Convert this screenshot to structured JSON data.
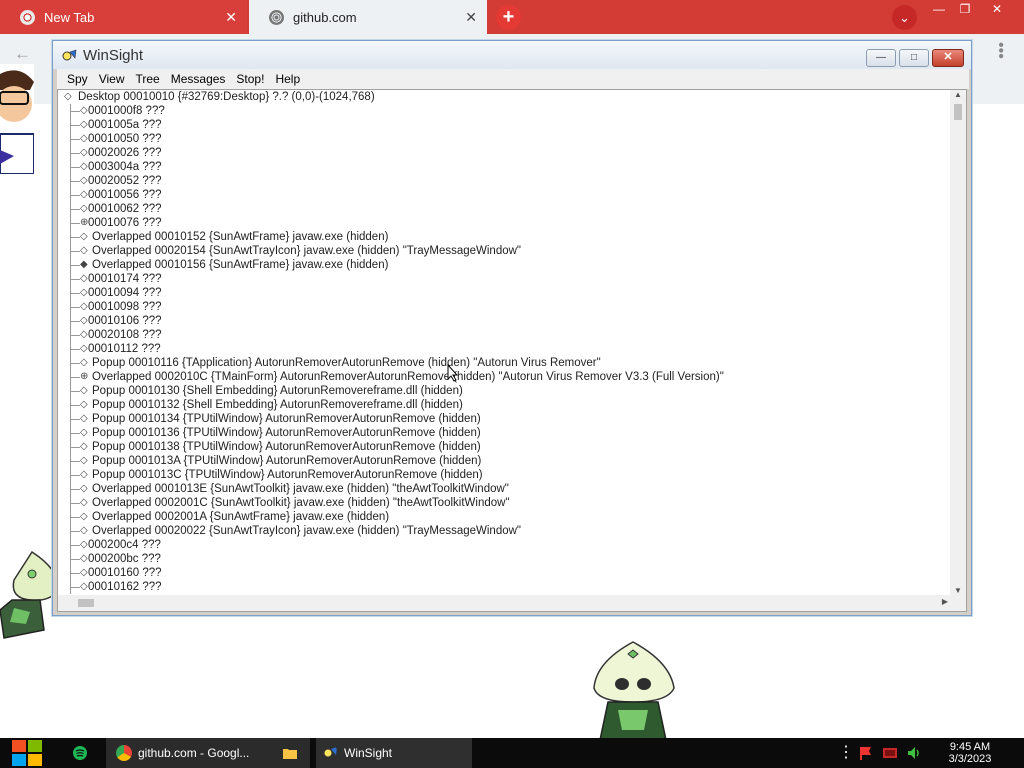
{
  "browser": {
    "tabs": [
      {
        "label": "New Tab",
        "close": "✕"
      },
      {
        "label": "github.com",
        "close": "✕"
      }
    ],
    "new_tab": "+",
    "profile": "⌄",
    "controls": {
      "minimize": "—",
      "maximize": "❐",
      "close": "✕"
    },
    "back": "←"
  },
  "winsight": {
    "title": "WinSight",
    "caption_buttons": {
      "minimize": "—",
      "maximize": "□",
      "close": "✕"
    },
    "menu": [
      "Spy",
      "View",
      "Tree",
      "Messages",
      "Stop!",
      "Help"
    ],
    "tree": [
      {
        "text": "Desktop 00010010 {#32769:Desktop} ?.? (0,0)-(1024,768)",
        "level": 0
      },
      {
        "text": "0001000f8 ???",
        "level": 1
      },
      {
        "text": "0001005a ???",
        "level": 1
      },
      {
        "text": "00010050 ???",
        "level": 1
      },
      {
        "text": "00020026 ???",
        "level": 1
      },
      {
        "text": "0003004a ???",
        "level": 1
      },
      {
        "text": "00020052 ???",
        "level": 1
      },
      {
        "text": "00010056 ???",
        "level": 1
      },
      {
        "text": "00010062 ???",
        "level": 1
      },
      {
        "text": "00010076 ???",
        "level": 1
      },
      {
        "text": "Overlapped 00010152 {SunAwtFrame} javaw.exe (hidden)",
        "level": 2
      },
      {
        "text": "Overlapped 00020154 {SunAwtTrayIcon} javaw.exe (hidden) \"TrayMessageWindow\"",
        "level": 2
      },
      {
        "text": "Overlapped 00010156 {SunAwtFrame} javaw.exe (hidden)",
        "level": 2
      },
      {
        "text": "00010174 ???",
        "level": 1
      },
      {
        "text": "00010094 ???",
        "level": 1
      },
      {
        "text": "00010098 ???",
        "level": 1
      },
      {
        "text": "00010106 ???",
        "level": 1
      },
      {
        "text": "00020108 ???",
        "level": 1
      },
      {
        "text": "00010112 ???",
        "level": 1
      },
      {
        "text": "Popup 00010116 {TApplication} AutorunRemoverAutorunRemove (hidden) \"Autorun Virus Remover\"",
        "level": 2
      },
      {
        "text": "Overlapped 0002010C {TMainForm} AutorunRemoverAutorunRemove (hidden) \"Autorun Virus Remover V3.3 (Full Version)\"",
        "level": 2
      },
      {
        "text": "Popup 00010130 {Shell Embedding} AutorunRemovereframe.dll (hidden)",
        "level": 2
      },
      {
        "text": "Popup 00010132 {Shell Embedding} AutorunRemovereframe.dll (hidden)",
        "level": 2
      },
      {
        "text": "Popup 00010134 {TPUtilWindow} AutorunRemoverAutorunRemove (hidden)",
        "level": 2
      },
      {
        "text": "Popup 00010136 {TPUtilWindow} AutorunRemoverAutorunRemove (hidden)",
        "level": 2
      },
      {
        "text": "Popup 00010138 {TPUtilWindow} AutorunRemoverAutorunRemove (hidden)",
        "level": 2
      },
      {
        "text": "Popup 0001013A {TPUtilWindow} AutorunRemoverAutorunRemove (hidden)",
        "level": 2
      },
      {
        "text": "Popup 0001013C {TPUtilWindow} AutorunRemoverAutorunRemove (hidden)",
        "level": 2
      },
      {
        "text": "Overlapped 0001013E {SunAwtToolkit} javaw.exe (hidden) \"theAwtToolkitWindow\"",
        "level": 2
      },
      {
        "text": "Overlapped 0002001C {SunAwtToolkit} javaw.exe (hidden) \"theAwtToolkitWindow\"",
        "level": 2
      },
      {
        "text": "Overlapped 0002001A {SunAwtFrame} javaw.exe (hidden)",
        "level": 2
      },
      {
        "text": "Overlapped 00020022 {SunAwtTrayIcon} javaw.exe (hidden) \"TrayMessageWindow\"",
        "level": 2
      },
      {
        "text": "000200c4 ???",
        "level": 1
      },
      {
        "text": "000200bc ???",
        "level": 1
      },
      {
        "text": "00010160 ???",
        "level": 1
      },
      {
        "text": "00010162 ???",
        "level": 1
      }
    ]
  },
  "taskbar": {
    "apps": [
      {
        "label": "github.com - Googl..."
      },
      {
        "label": "WinSight"
      }
    ],
    "clock": {
      "time": "9:45 AM",
      "date": "3/3/2023"
    }
  },
  "colors": {
    "tab_strip": "#d33b35",
    "active_tab": "#eef1f4",
    "taskbar": "#0b0b0b",
    "window_frame": "#d4d0c8"
  }
}
